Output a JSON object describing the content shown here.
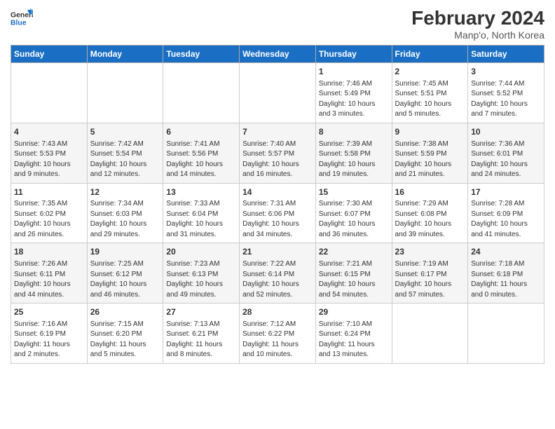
{
  "header": {
    "logo_line1": "General",
    "logo_line2": "Blue",
    "title": "February 2024",
    "subtitle": "Manp'o, North Korea"
  },
  "columns": [
    "Sunday",
    "Monday",
    "Tuesday",
    "Wednesday",
    "Thursday",
    "Friday",
    "Saturday"
  ],
  "weeks": [
    {
      "days": [
        {
          "num": "",
          "info": ""
        },
        {
          "num": "",
          "info": ""
        },
        {
          "num": "",
          "info": ""
        },
        {
          "num": "",
          "info": ""
        },
        {
          "num": "1",
          "info": "Sunrise: 7:46 AM\nSunset: 5:49 PM\nDaylight: 10 hours\nand 3 minutes."
        },
        {
          "num": "2",
          "info": "Sunrise: 7:45 AM\nSunset: 5:51 PM\nDaylight: 10 hours\nand 5 minutes."
        },
        {
          "num": "3",
          "info": "Sunrise: 7:44 AM\nSunset: 5:52 PM\nDaylight: 10 hours\nand 7 minutes."
        }
      ]
    },
    {
      "days": [
        {
          "num": "4",
          "info": "Sunrise: 7:43 AM\nSunset: 5:53 PM\nDaylight: 10 hours\nand 9 minutes."
        },
        {
          "num": "5",
          "info": "Sunrise: 7:42 AM\nSunset: 5:54 PM\nDaylight: 10 hours\nand 12 minutes."
        },
        {
          "num": "6",
          "info": "Sunrise: 7:41 AM\nSunset: 5:56 PM\nDaylight: 10 hours\nand 14 minutes."
        },
        {
          "num": "7",
          "info": "Sunrise: 7:40 AM\nSunset: 5:57 PM\nDaylight: 10 hours\nand 16 minutes."
        },
        {
          "num": "8",
          "info": "Sunrise: 7:39 AM\nSunset: 5:58 PM\nDaylight: 10 hours\nand 19 minutes."
        },
        {
          "num": "9",
          "info": "Sunrise: 7:38 AM\nSunset: 5:59 PM\nDaylight: 10 hours\nand 21 minutes."
        },
        {
          "num": "10",
          "info": "Sunrise: 7:36 AM\nSunset: 6:01 PM\nDaylight: 10 hours\nand 24 minutes."
        }
      ]
    },
    {
      "days": [
        {
          "num": "11",
          "info": "Sunrise: 7:35 AM\nSunset: 6:02 PM\nDaylight: 10 hours\nand 26 minutes."
        },
        {
          "num": "12",
          "info": "Sunrise: 7:34 AM\nSunset: 6:03 PM\nDaylight: 10 hours\nand 29 minutes."
        },
        {
          "num": "13",
          "info": "Sunrise: 7:33 AM\nSunset: 6:04 PM\nDaylight: 10 hours\nand 31 minutes."
        },
        {
          "num": "14",
          "info": "Sunrise: 7:31 AM\nSunset: 6:06 PM\nDaylight: 10 hours\nand 34 minutes."
        },
        {
          "num": "15",
          "info": "Sunrise: 7:30 AM\nSunset: 6:07 PM\nDaylight: 10 hours\nand 36 minutes."
        },
        {
          "num": "16",
          "info": "Sunrise: 7:29 AM\nSunset: 6:08 PM\nDaylight: 10 hours\nand 39 minutes."
        },
        {
          "num": "17",
          "info": "Sunrise: 7:28 AM\nSunset: 6:09 PM\nDaylight: 10 hours\nand 41 minutes."
        }
      ]
    },
    {
      "days": [
        {
          "num": "18",
          "info": "Sunrise: 7:26 AM\nSunset: 6:11 PM\nDaylight: 10 hours\nand 44 minutes."
        },
        {
          "num": "19",
          "info": "Sunrise: 7:25 AM\nSunset: 6:12 PM\nDaylight: 10 hours\nand 46 minutes."
        },
        {
          "num": "20",
          "info": "Sunrise: 7:23 AM\nSunset: 6:13 PM\nDaylight: 10 hours\nand 49 minutes."
        },
        {
          "num": "21",
          "info": "Sunrise: 7:22 AM\nSunset: 6:14 PM\nDaylight: 10 hours\nand 52 minutes."
        },
        {
          "num": "22",
          "info": "Sunrise: 7:21 AM\nSunset: 6:15 PM\nDaylight: 10 hours\nand 54 minutes."
        },
        {
          "num": "23",
          "info": "Sunrise: 7:19 AM\nSunset: 6:17 PM\nDaylight: 10 hours\nand 57 minutes."
        },
        {
          "num": "24",
          "info": "Sunrise: 7:18 AM\nSunset: 6:18 PM\nDaylight: 11 hours\nand 0 minutes."
        }
      ]
    },
    {
      "days": [
        {
          "num": "25",
          "info": "Sunrise: 7:16 AM\nSunset: 6:19 PM\nDaylight: 11 hours\nand 2 minutes."
        },
        {
          "num": "26",
          "info": "Sunrise: 7:15 AM\nSunset: 6:20 PM\nDaylight: 11 hours\nand 5 minutes."
        },
        {
          "num": "27",
          "info": "Sunrise: 7:13 AM\nSunset: 6:21 PM\nDaylight: 11 hours\nand 8 minutes."
        },
        {
          "num": "28",
          "info": "Sunrise: 7:12 AM\nSunset: 6:22 PM\nDaylight: 11 hours\nand 10 minutes."
        },
        {
          "num": "29",
          "info": "Sunrise: 7:10 AM\nSunset: 6:24 PM\nDaylight: 11 hours\nand 13 minutes."
        },
        {
          "num": "",
          "info": ""
        },
        {
          "num": "",
          "info": ""
        }
      ]
    }
  ]
}
